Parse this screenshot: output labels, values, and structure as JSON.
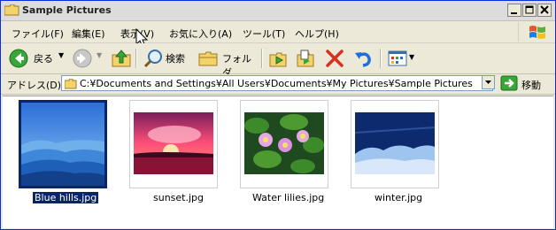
{
  "window": {
    "title": "Sample Pictures"
  },
  "menu": [
    "ファイル(F)",
    "編集(E)",
    "表示(V)",
    "お気に入り(A)",
    "ツール(T)",
    "ヘルプ(H)"
  ],
  "toolbar": {
    "back_label": "戻る",
    "search_label": "検索",
    "folders_label": "フォルダ"
  },
  "address": {
    "label": "アドレス(D)",
    "path": "C:¥Documents and Settings¥All Users¥Documents¥My Pictures¥Sample Pictures",
    "go_label": "移動"
  },
  "files": [
    {
      "name": "Blue hills.jpg",
      "selected": true
    },
    {
      "name": "sunset.jpg",
      "selected": false
    },
    {
      "name": "Water lilies.jpg",
      "selected": false
    },
    {
      "name": "winter.jpg",
      "selected": false
    }
  ],
  "colors": {
    "selection": "#0a246a",
    "toolbar_bg": "#ece9d8"
  }
}
